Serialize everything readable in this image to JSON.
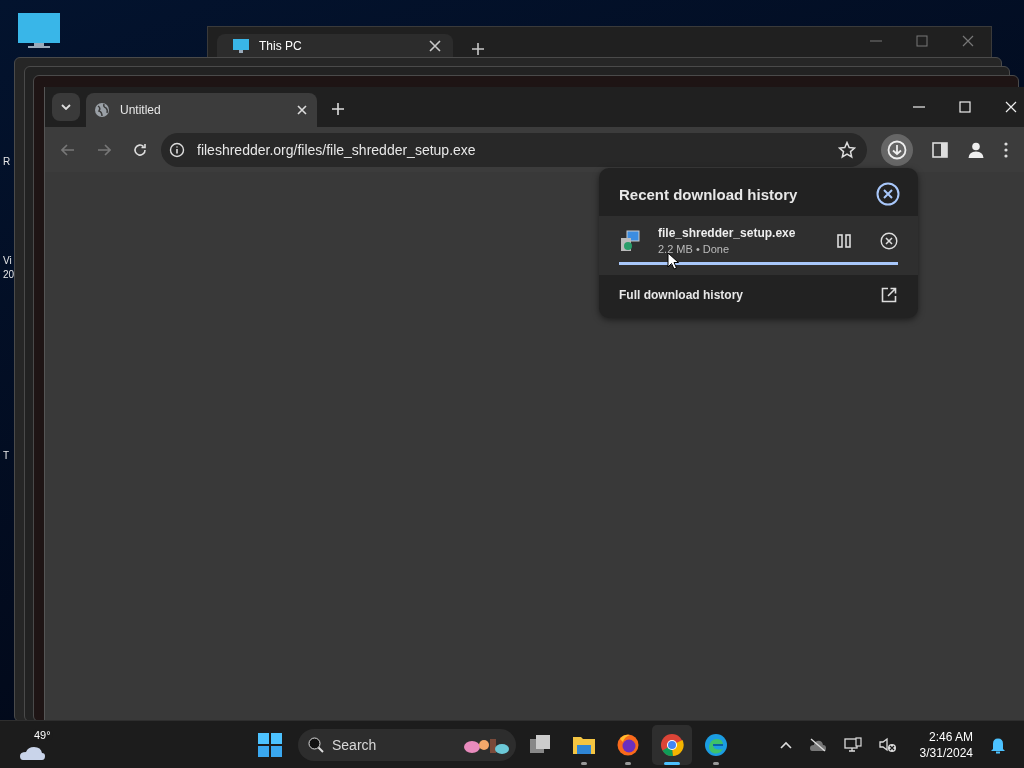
{
  "desktop": {
    "icon_labels": [
      "R",
      "Vi",
      "20",
      "T"
    ]
  },
  "back_window": {
    "tab_title": "This PC"
  },
  "browser": {
    "tabs": [
      {
        "title": "Untitled",
        "selected": true
      }
    ],
    "address": "fileshredder.org/files/file_shredder_setup.exe",
    "downloads_button": {
      "active": true
    }
  },
  "download_popup": {
    "title": "Recent download history",
    "items": [
      {
        "filename": "file_shredder_setup.exe",
        "status": "2.2 MB • Done",
        "level": 1.0
      }
    ],
    "footer": "Full download history"
  },
  "taskbar": {
    "weather": "49°",
    "search": {
      "placeholder": "Search"
    },
    "apps": [
      {
        "kind": "taskview",
        "running": false,
        "selected": false
      },
      {
        "kind": "files",
        "running": true,
        "selected": false
      },
      {
        "kind": "firefox",
        "running": true,
        "selected": false
      },
      {
        "kind": "chrome",
        "running": true,
        "selected": true
      },
      {
        "kind": "edge",
        "running": true,
        "selected": false
      }
    ],
    "time": "2:46 AM",
    "date": "3/31/2024"
  }
}
